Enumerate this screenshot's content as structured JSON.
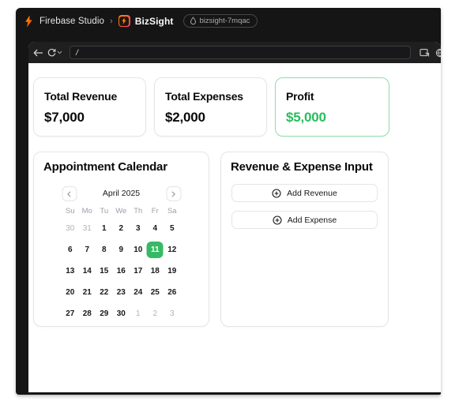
{
  "header": {
    "app_name": "Firebase Studio",
    "separator": "›",
    "project_name": "BizSight",
    "workspace_badge": "bizsight-7mqac"
  },
  "toolbar": {
    "url": "/"
  },
  "stats": [
    {
      "title": "Total Revenue",
      "value": "$7,000"
    },
    {
      "title": "Total Expenses",
      "value": "$2,000"
    },
    {
      "title": "Profit",
      "value": "$5,000"
    }
  ],
  "calendar": {
    "title": "Appointment Calendar",
    "month_label": "April 2025",
    "weekdays": [
      "Su",
      "Mo",
      "Tu",
      "We",
      "Th",
      "Fr",
      "Sa"
    ],
    "days": [
      {
        "d": "30",
        "muted": true
      },
      {
        "d": "31",
        "muted": true
      },
      {
        "d": "1"
      },
      {
        "d": "2"
      },
      {
        "d": "3"
      },
      {
        "d": "4"
      },
      {
        "d": "5"
      },
      {
        "d": "6"
      },
      {
        "d": "7"
      },
      {
        "d": "8"
      },
      {
        "d": "9"
      },
      {
        "d": "10"
      },
      {
        "d": "11",
        "selected": true
      },
      {
        "d": "12"
      },
      {
        "d": "13"
      },
      {
        "d": "14"
      },
      {
        "d": "15"
      },
      {
        "d": "16"
      },
      {
        "d": "17"
      },
      {
        "d": "18"
      },
      {
        "d": "19"
      },
      {
        "d": "20"
      },
      {
        "d": "21"
      },
      {
        "d": "22"
      },
      {
        "d": "23"
      },
      {
        "d": "24"
      },
      {
        "d": "25"
      },
      {
        "d": "26"
      },
      {
        "d": "27"
      },
      {
        "d": "28"
      },
      {
        "d": "29"
      },
      {
        "d": "30"
      },
      {
        "d": "1",
        "muted": true
      },
      {
        "d": "2",
        "muted": true
      },
      {
        "d": "3",
        "muted": true
      }
    ]
  },
  "input_panel": {
    "title": "Revenue & Expense Input",
    "buttons": [
      {
        "label": "Add Revenue"
      },
      {
        "label": "Add Expense"
      }
    ]
  },
  "colors": {
    "accent_green": "#38b966",
    "profit_value": "#27bd5e",
    "profit_border": "#8ddfa7",
    "frame_dark": "#151515",
    "toolbar_dark": "#1f1f1f"
  },
  "icons": {
    "logo": "flame-icon",
    "project": "bolt-icon",
    "badge": "drop-icon",
    "back": "arrow-left-icon",
    "reload": "reload-icon",
    "reload_menu": "chevron-down-icon",
    "open_external": "popout-icon",
    "clipped_right": "globe-icon",
    "calendar_prev": "chevron-left-icon",
    "calendar_next": "chevron-right-icon",
    "add": "plus-circle-icon"
  }
}
